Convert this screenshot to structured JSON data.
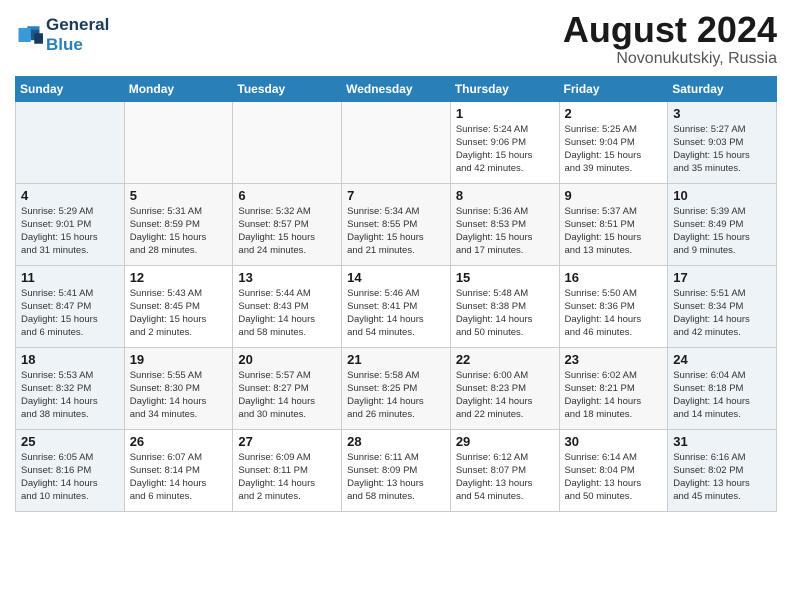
{
  "header": {
    "logo_line1": "General",
    "logo_line2": "Blue",
    "month_year": "August 2024",
    "location": "Novonukutskiy, Russia"
  },
  "days_of_week": [
    "Sunday",
    "Monday",
    "Tuesday",
    "Wednesday",
    "Thursday",
    "Friday",
    "Saturday"
  ],
  "weeks": [
    [
      {
        "day": "",
        "info": ""
      },
      {
        "day": "",
        "info": ""
      },
      {
        "day": "",
        "info": ""
      },
      {
        "day": "",
        "info": ""
      },
      {
        "day": "1",
        "info": "Sunrise: 5:24 AM\nSunset: 9:06 PM\nDaylight: 15 hours\nand 42 minutes."
      },
      {
        "day": "2",
        "info": "Sunrise: 5:25 AM\nSunset: 9:04 PM\nDaylight: 15 hours\nand 39 minutes."
      },
      {
        "day": "3",
        "info": "Sunrise: 5:27 AM\nSunset: 9:03 PM\nDaylight: 15 hours\nand 35 minutes."
      }
    ],
    [
      {
        "day": "4",
        "info": "Sunrise: 5:29 AM\nSunset: 9:01 PM\nDaylight: 15 hours\nand 31 minutes."
      },
      {
        "day": "5",
        "info": "Sunrise: 5:31 AM\nSunset: 8:59 PM\nDaylight: 15 hours\nand 28 minutes."
      },
      {
        "day": "6",
        "info": "Sunrise: 5:32 AM\nSunset: 8:57 PM\nDaylight: 15 hours\nand 24 minutes."
      },
      {
        "day": "7",
        "info": "Sunrise: 5:34 AM\nSunset: 8:55 PM\nDaylight: 15 hours\nand 21 minutes."
      },
      {
        "day": "8",
        "info": "Sunrise: 5:36 AM\nSunset: 8:53 PM\nDaylight: 15 hours\nand 17 minutes."
      },
      {
        "day": "9",
        "info": "Sunrise: 5:37 AM\nSunset: 8:51 PM\nDaylight: 15 hours\nand 13 minutes."
      },
      {
        "day": "10",
        "info": "Sunrise: 5:39 AM\nSunset: 8:49 PM\nDaylight: 15 hours\nand 9 minutes."
      }
    ],
    [
      {
        "day": "11",
        "info": "Sunrise: 5:41 AM\nSunset: 8:47 PM\nDaylight: 15 hours\nand 6 minutes."
      },
      {
        "day": "12",
        "info": "Sunrise: 5:43 AM\nSunset: 8:45 PM\nDaylight: 15 hours\nand 2 minutes."
      },
      {
        "day": "13",
        "info": "Sunrise: 5:44 AM\nSunset: 8:43 PM\nDaylight: 14 hours\nand 58 minutes."
      },
      {
        "day": "14",
        "info": "Sunrise: 5:46 AM\nSunset: 8:41 PM\nDaylight: 14 hours\nand 54 minutes."
      },
      {
        "day": "15",
        "info": "Sunrise: 5:48 AM\nSunset: 8:38 PM\nDaylight: 14 hours\nand 50 minutes."
      },
      {
        "day": "16",
        "info": "Sunrise: 5:50 AM\nSunset: 8:36 PM\nDaylight: 14 hours\nand 46 minutes."
      },
      {
        "day": "17",
        "info": "Sunrise: 5:51 AM\nSunset: 8:34 PM\nDaylight: 14 hours\nand 42 minutes."
      }
    ],
    [
      {
        "day": "18",
        "info": "Sunrise: 5:53 AM\nSunset: 8:32 PM\nDaylight: 14 hours\nand 38 minutes."
      },
      {
        "day": "19",
        "info": "Sunrise: 5:55 AM\nSunset: 8:30 PM\nDaylight: 14 hours\nand 34 minutes."
      },
      {
        "day": "20",
        "info": "Sunrise: 5:57 AM\nSunset: 8:27 PM\nDaylight: 14 hours\nand 30 minutes."
      },
      {
        "day": "21",
        "info": "Sunrise: 5:58 AM\nSunset: 8:25 PM\nDaylight: 14 hours\nand 26 minutes."
      },
      {
        "day": "22",
        "info": "Sunrise: 6:00 AM\nSunset: 8:23 PM\nDaylight: 14 hours\nand 22 minutes."
      },
      {
        "day": "23",
        "info": "Sunrise: 6:02 AM\nSunset: 8:21 PM\nDaylight: 14 hours\nand 18 minutes."
      },
      {
        "day": "24",
        "info": "Sunrise: 6:04 AM\nSunset: 8:18 PM\nDaylight: 14 hours\nand 14 minutes."
      }
    ],
    [
      {
        "day": "25",
        "info": "Sunrise: 6:05 AM\nSunset: 8:16 PM\nDaylight: 14 hours\nand 10 minutes."
      },
      {
        "day": "26",
        "info": "Sunrise: 6:07 AM\nSunset: 8:14 PM\nDaylight: 14 hours\nand 6 minutes."
      },
      {
        "day": "27",
        "info": "Sunrise: 6:09 AM\nSunset: 8:11 PM\nDaylight: 14 hours\nand 2 minutes."
      },
      {
        "day": "28",
        "info": "Sunrise: 6:11 AM\nSunset: 8:09 PM\nDaylight: 13 hours\nand 58 minutes."
      },
      {
        "day": "29",
        "info": "Sunrise: 6:12 AM\nSunset: 8:07 PM\nDaylight: 13 hours\nand 54 minutes."
      },
      {
        "day": "30",
        "info": "Sunrise: 6:14 AM\nSunset: 8:04 PM\nDaylight: 13 hours\nand 50 minutes."
      },
      {
        "day": "31",
        "info": "Sunrise: 6:16 AM\nSunset: 8:02 PM\nDaylight: 13 hours\nand 45 minutes."
      }
    ]
  ]
}
